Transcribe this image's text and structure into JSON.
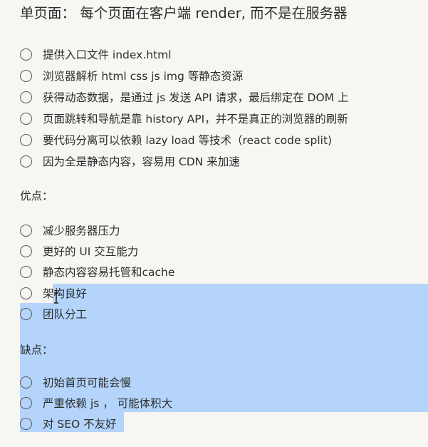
{
  "title": "单页面： 每个页面在客户端 render, 而不是在服务器",
  "features": [
    {
      "label": "提供入口文件 index.html"
    },
    {
      "label": "浏览器解析 html css js img 等静态资源"
    },
    {
      "label": "获得动态数据，是通过 js 发送 API 请求，最后绑定在 DOM 上"
    },
    {
      "label": "页面跳转和导航是靠 history API，并不是真正的浏览器的刷新"
    },
    {
      "label": "要代码分离可以依赖 lazy load 等技术（react code split)"
    },
    {
      "label": "因为全是静态内容，容易用 CDN 来加速"
    }
  ],
  "pros_heading": "优点：",
  "pros": [
    {
      "label": "减少服务器压力"
    },
    {
      "label": "更好的 UI 交互能力"
    },
    {
      "label": "静态内容容易托管和cache"
    },
    {
      "label": "架构良好"
    },
    {
      "label": "团队分工"
    }
  ],
  "cons_heading": "缺点：",
  "cons": [
    {
      "label": "初始首页可能会慢"
    },
    {
      "label": "严重依赖 js ， 可能体积大"
    },
    {
      "label": "对 SEO 不友好"
    }
  ],
  "colors": {
    "background": "#f7f6f3",
    "selection": "#b4d4fb",
    "text": "#2d2d2d"
  },
  "icons": [
    "radio-checkbox-icon",
    "text-cursor-icon"
  ]
}
